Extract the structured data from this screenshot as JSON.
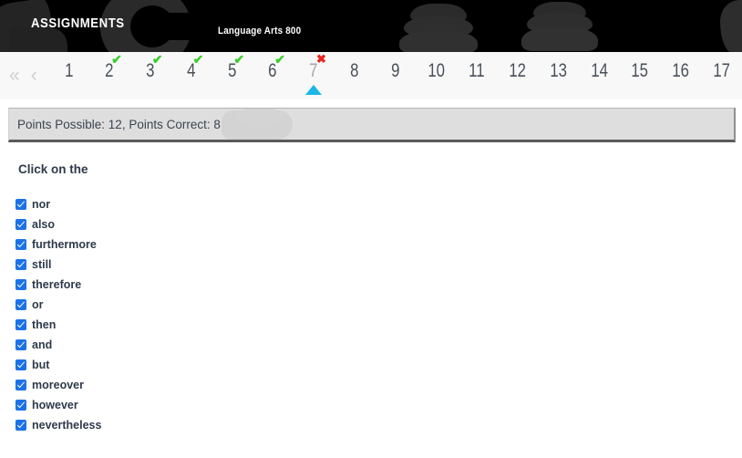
{
  "header": {
    "title": "ASSIGNMENTS",
    "course": "Language Arts 800"
  },
  "pager": {
    "first_icon": "«",
    "prev_icon": "‹",
    "check_icon": "✔",
    "cross_icon": "✖",
    "items": [
      {
        "label": "1",
        "status": "none"
      },
      {
        "label": "2",
        "status": "correct"
      },
      {
        "label": "3",
        "status": "correct"
      },
      {
        "label": "4",
        "status": "correct"
      },
      {
        "label": "5",
        "status": "correct"
      },
      {
        "label": "6",
        "status": "correct"
      },
      {
        "label": "7",
        "status": "incorrect"
      },
      {
        "label": "8",
        "status": "none"
      },
      {
        "label": "9",
        "status": "none"
      },
      {
        "label": "10",
        "status": "none"
      },
      {
        "label": "11",
        "status": "none"
      },
      {
        "label": "12",
        "status": "none"
      },
      {
        "label": "13",
        "status": "none"
      },
      {
        "label": "14",
        "status": "none"
      },
      {
        "label": "15",
        "status": "none"
      },
      {
        "label": "16",
        "status": "none"
      },
      {
        "label": "17",
        "status": "none"
      }
    ],
    "current_index": 6
  },
  "score": {
    "text": "Points Possible: 12,  Points Correct: 8",
    "points_possible": 12,
    "points_correct": 8
  },
  "question": {
    "prompt": "Click on the"
  },
  "options": [
    {
      "label": "nor",
      "checked": true
    },
    {
      "label": "also",
      "checked": true
    },
    {
      "label": "furthermore",
      "checked": true
    },
    {
      "label": "still",
      "checked": true
    },
    {
      "label": "therefore",
      "checked": true
    },
    {
      "label": "or",
      "checked": true
    },
    {
      "label": "then",
      "checked": true
    },
    {
      "label": "and",
      "checked": true
    },
    {
      "label": "but",
      "checked": true
    },
    {
      "label": "moreover",
      "checked": true
    },
    {
      "label": "however",
      "checked": true
    },
    {
      "label": "nevertheless",
      "checked": true
    }
  ],
  "colors": {
    "header_bg": "#000000",
    "pager_bg": "#f8f8f8",
    "points_bar_bg": "#dedede",
    "correct_green": "#37d02a",
    "incorrect_red": "#e8241c",
    "current_caret": "#19b6e8",
    "checkbox_blue": "#1b72e8",
    "text_navy": "#2f3a4a"
  }
}
